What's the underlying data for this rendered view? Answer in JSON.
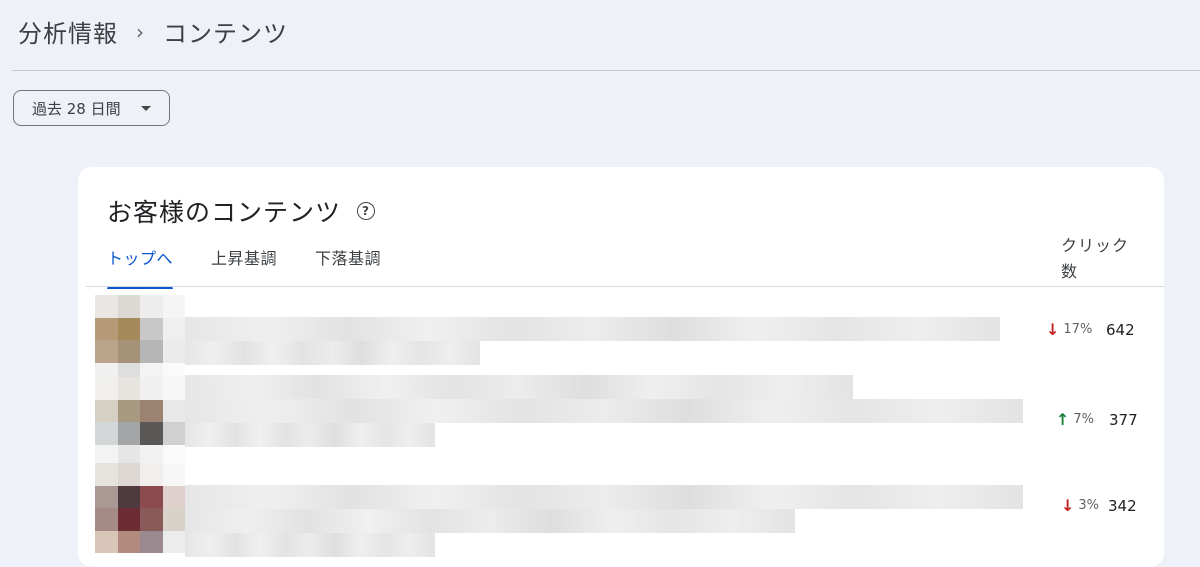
{
  "breadcrumb": {
    "parent": "分析情報",
    "separator": "›",
    "current": "コンテンツ"
  },
  "date_range": {
    "selected": "過去 28 日間"
  },
  "card": {
    "title": "お客様のコンテンツ",
    "tabs": [
      {
        "label": "トップへ",
        "active": true
      },
      {
        "label": "上昇基調",
        "active": false
      },
      {
        "label": "下落基調",
        "active": false
      }
    ],
    "column_header": "クリック数",
    "rows": [
      {
        "trend": "down",
        "change": "17%",
        "clicks": "642"
      },
      {
        "trend": "up",
        "change": "7%",
        "clicks": "377"
      },
      {
        "trend": "down",
        "change": "3%",
        "clicks": "342"
      }
    ]
  },
  "colors": {
    "accent": "#0b57d0",
    "down": "#c5221f",
    "up": "#188038",
    "background": "#eef1f7"
  },
  "icons": {
    "help": "help-circle-icon",
    "caret": "caret-down-icon",
    "down": "arrow-down-icon",
    "up": "arrow-up-icon"
  }
}
